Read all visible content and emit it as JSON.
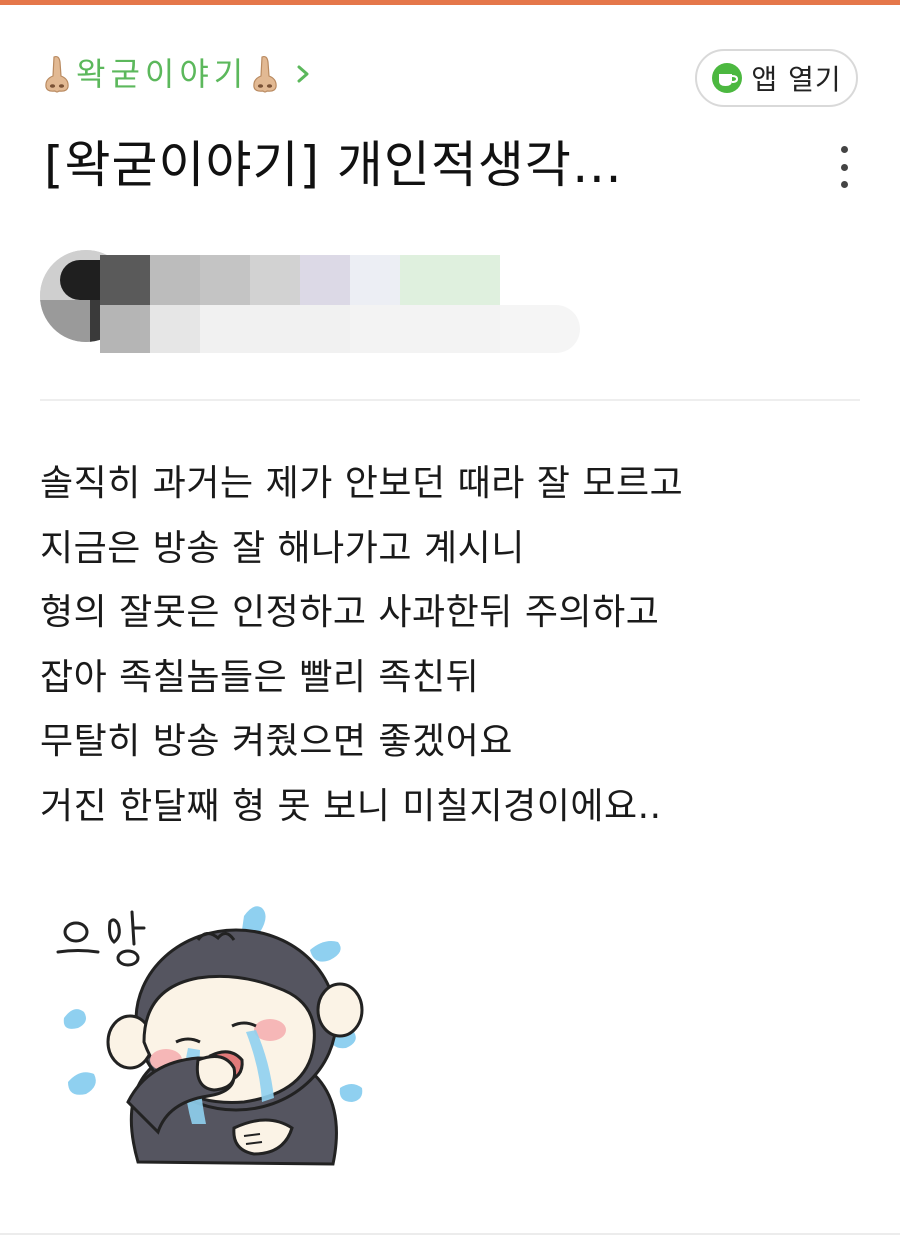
{
  "board": {
    "name": "왁굳이야기",
    "icon_left": "nose-emoji-icon",
    "icon_right": "nose-emoji-icon",
    "chevron": "chevron-right-icon"
  },
  "app_button": {
    "label": "앱 열기",
    "icon": "cafe-cup-icon"
  },
  "post": {
    "title": "[왁굳이야기] 개인적생각…",
    "more_icon": "more-vertical-icon",
    "body_lines": [
      "솔직히 과거는 제가 안보던 때라 잘 모르고",
      "지금은 방송 잘 해나가고 계시니",
      "형의 잘못은 인정하고 사과한뒤 주의하고",
      "잡아 족칠놈들은 빨리 족친뒤",
      "무탈히 방송 켜줬으면 좋겠어요",
      "거진 한달째 형 못 보니 미칠지경이에요.."
    ]
  },
  "sticker": {
    "text": "으앙",
    "icon": "crying-monkey-sticker"
  },
  "colors": {
    "top_accent": "#e5774a",
    "board_green": "#5cb85c",
    "cafe_green": "#4cb840",
    "sticker_tear": "#8fd0f0",
    "sticker_dark": "#555560",
    "sticker_face": "#fbf3e6",
    "sticker_blush": "#f6b7b7",
    "sticker_mouth": "#e27a7a"
  }
}
